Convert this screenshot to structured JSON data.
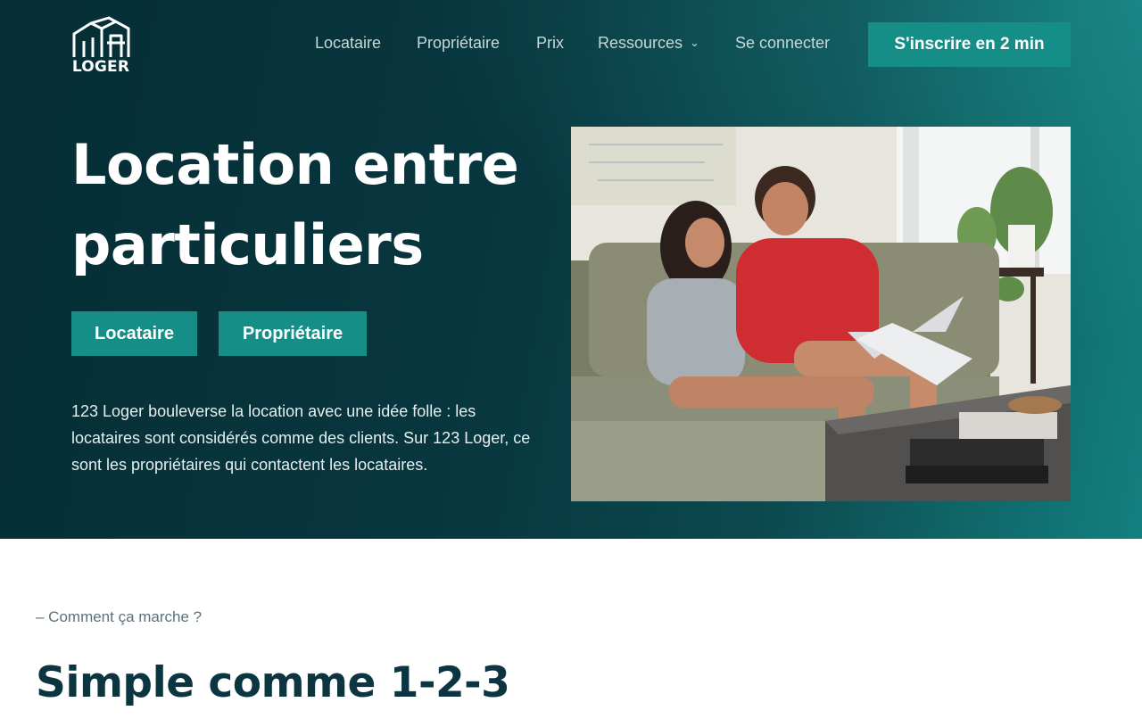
{
  "brand": {
    "name": "LOGER",
    "primary_color": "#168e88",
    "dark_color": "#08373f"
  },
  "nav": {
    "items": [
      {
        "label": "Locataire"
      },
      {
        "label": "Propriétaire"
      },
      {
        "label": "Prix"
      },
      {
        "label": "Ressources",
        "has_dropdown": true
      },
      {
        "label": "Se connecter"
      }
    ],
    "cta_label": "S'inscrire en 2 min"
  },
  "hero": {
    "title_line1": "Location entre",
    "title_line2": "particuliers",
    "buttons": {
      "tenant": "Locataire",
      "owner": "Propriétaire"
    },
    "description": "123 Loger bouleverse la location avec une idée folle : les locataires sont considérés comme des clients. Sur 123 Loger, ce sont les propriétaires qui contactent les locataires."
  },
  "section": {
    "kicker": "– Comment ça marche ?",
    "title": "Simple comme 1-2-3"
  }
}
